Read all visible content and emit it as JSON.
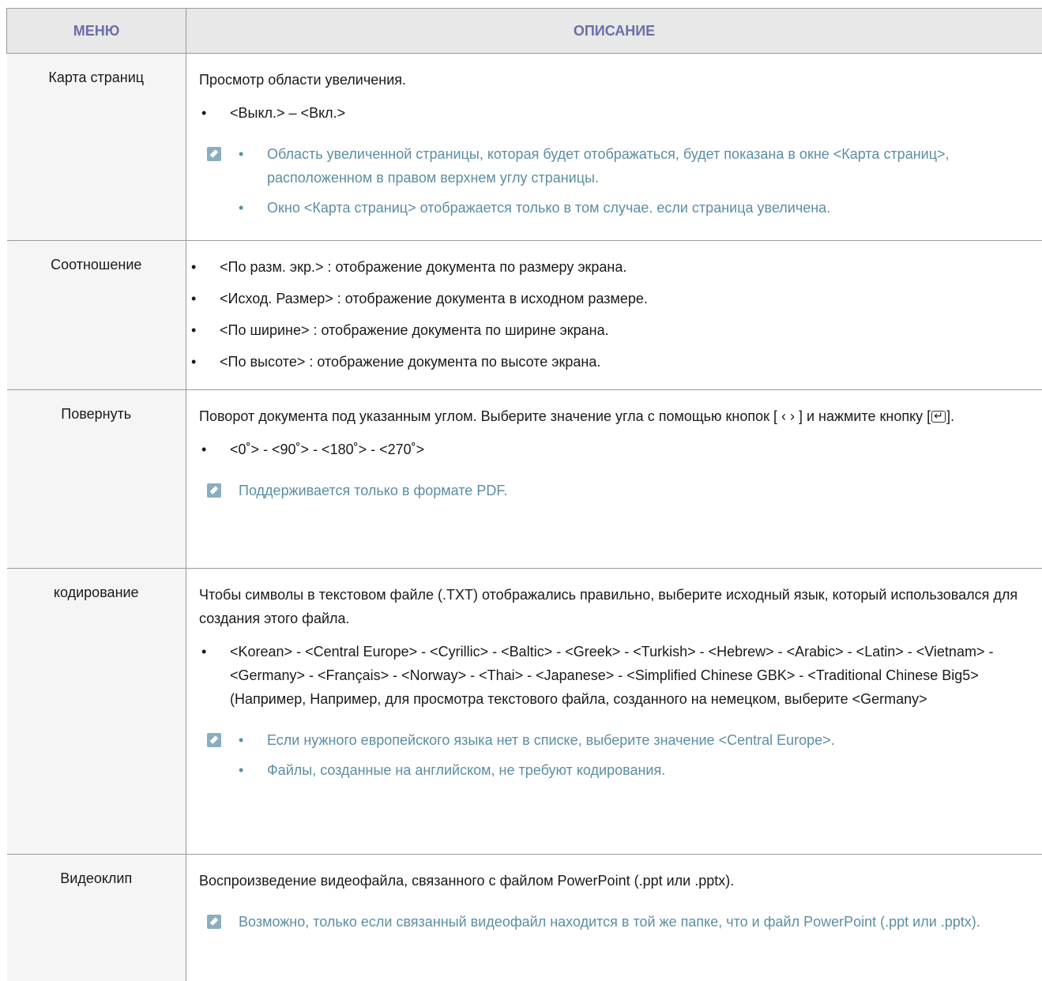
{
  "header": {
    "menu": "МЕНЮ",
    "description": "ОПИСАНИЕ"
  },
  "rows": [
    {
      "menu": "Карта страниц",
      "intro": "Просмотр области увеличения.",
      "bullets": [
        "<Выкл.> – <Вкл.>"
      ],
      "notes": [
        "Область увеличенной страницы, которая будет отображаться, будет показана в окне <Карта страниц>, расположенном в правом верхнем углу страницы.",
        "Окно <Карта страниц> отображается только в том случае. если страница увеличена."
      ]
    },
    {
      "menu": "Соотношение",
      "bullets": [
        "<По разм. экр.> : отображение документа по размеру экрана.",
        "<Исход. Размер> : отображение документа в исходном размере.",
        "<По ширине> : отображение документа по ширине экрана.",
        "<По высоте> : отображение документа по высоте экрана."
      ]
    },
    {
      "menu": "Повернуть",
      "intro_a": "Поворот документа под указанным углом. Выберите значение угла с помощью кнопок [ ‹ › ] и нажмите кнопку [",
      "intro_b": "].",
      "bullets": [
        "<0˚> - <90˚> - <180˚> - <270˚>"
      ],
      "note": "Поддерживается только в формате PDF."
    },
    {
      "menu": "кодирование",
      "intro": "Чтобы символы в текстовом файле (.TXT) отображались правильно, выберите исходный язык, который использовался для создания этого файла.",
      "bullet_list": "<Korean> - <Central Europe> - <Cyrillic> - <Baltic> - <Greek> - <Turkish> - <Hebrew> - <Arabic> - <Latin> - <Vietnam> - <Germany> - <Français> - <Norway> - <Thai> - <Japanese> - <Simplified Chinese GBK> - <Traditional Chinese Big5>",
      "bullet_example": "(Например, Например, для просмотра текстового файла, созданного на немецком, выберите <Germany>",
      "notes": [
        "Если нужного европейского языка нет в списке, выберите значение <Central Europe>.",
        "Файлы, созданные на английском, не требуют кодирования."
      ]
    },
    {
      "menu": "Видеоклип",
      "intro": "Воспроизведение видеофайла, связанного с файлом PowerPoint (.ppt или .pptx).",
      "note": "Возможно, только если связанный видеофайл находится в той же папке, что и файл PowerPoint (.ppt или .pptx)."
    }
  ]
}
